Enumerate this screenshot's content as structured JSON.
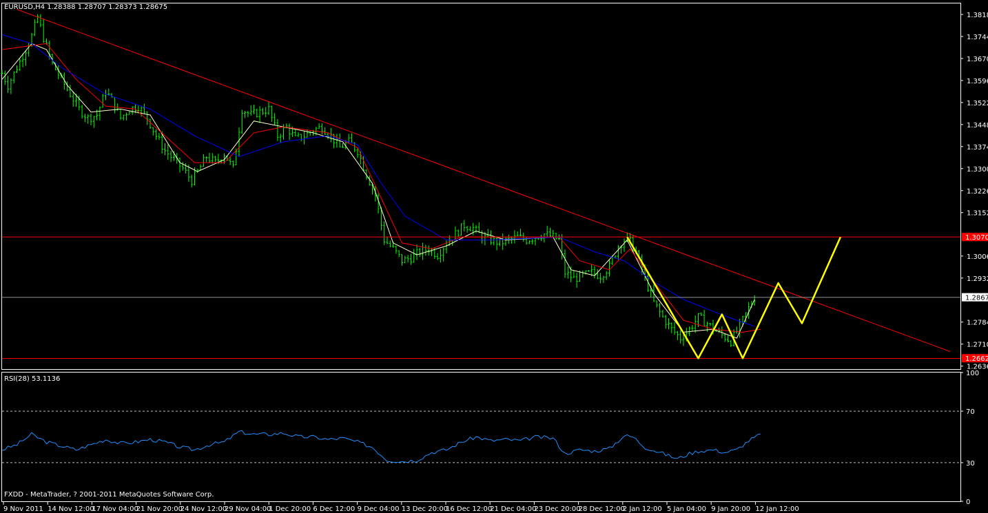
{
  "header": {
    "symbol_info": "EURUSD,H4  1.28388 1.28707 1.28373 1.28675"
  },
  "indicator": {
    "label": "RSI(28) 53.1136"
  },
  "footer": {
    "copyright": "FXDD - MetaTrader, ? 2001-2011 MetaQuotes Software Corp."
  },
  "colors": {
    "background": "#000000",
    "frame": "#ffffff",
    "candle": "#00ff00",
    "ma_fast": "#ffffcc",
    "ma_mid": "#ff0000",
    "ma_slow": "#0000ff",
    "trendline": "#ff0000",
    "level_line": "#ff0000",
    "current_line": "#c0c0c0",
    "rsi_line": "#1e90ff",
    "pattern": "#ffff00",
    "price_tag": "#ff0000"
  },
  "chart_data": {
    "type": "candlestick",
    "symbol": "EURUSD",
    "timeframe": "H4",
    "ylim": [
      1.2626,
      1.3855
    ],
    "y_ticks": [
      "1.38180",
      "1.37440",
      "1.36700",
      "1.35960",
      "1.35220",
      "1.34480",
      "1.33740",
      "1.33000",
      "1.32260",
      "1.31520",
      "1.30060",
      "1.29320",
      "1.27840",
      "1.27100",
      "1.26360"
    ],
    "x_ticks": [
      "9 Nov 2011",
      "14 Nov 12:00",
      "17 Nov 04:00",
      "21 Nov 20:00",
      "24 Nov 12:00",
      "29 Nov 04:00",
      "1 Dec 20:00",
      "6 Dec 12:00",
      "9 Dec 04:00",
      "13 Dec 20:00",
      "16 Dec 12:00",
      "21 Dec 04:00",
      "23 Dec 20:00",
      "28 Dec 12:00",
      "2 Jan 12:00",
      "5 Jan 04:00",
      "9 Jan 20:00",
      "12 Jan 12:00"
    ],
    "current_price": "1.28675",
    "tagged_levels": [
      "1.30700",
      "1.26625"
    ],
    "close_path": [
      [
        0,
        1.362
      ],
      [
        2,
        1.358
      ],
      [
        5,
        1.364
      ],
      [
        8,
        1.37
      ],
      [
        10,
        1.3745
      ],
      [
        12,
        1.381
      ],
      [
        14,
        1.374
      ],
      [
        17,
        1.365
      ],
      [
        20,
        1.36
      ],
      [
        23,
        1.355
      ],
      [
        26,
        1.35
      ],
      [
        29,
        1.347
      ],
      [
        32,
        1.348
      ],
      [
        35,
        1.356
      ],
      [
        37,
        1.353
      ],
      [
        40,
        1.347
      ],
      [
        43,
        1.35
      ],
      [
        46,
        1.351
      ],
      [
        49,
        1.347
      ],
      [
        52,
        1.341
      ],
      [
        55,
        1.336
      ],
      [
        58,
        1.333
      ],
      [
        61,
        1.33
      ],
      [
        64,
        1.326
      ],
      [
        66,
        1.329
      ],
      [
        69,
        1.334
      ],
      [
        72,
        1.332
      ],
      [
        75,
        1.335
      ],
      [
        78,
        1.33
      ],
      [
        81,
        1.35
      ],
      [
        84,
        1.348
      ],
      [
        87,
        1.349
      ],
      [
        90,
        1.35
      ],
      [
        93,
        1.341
      ],
      [
        96,
        1.344
      ],
      [
        99,
        1.34
      ],
      [
        102,
        1.341
      ],
      [
        105,
        1.343
      ],
      [
        108,
        1.344
      ],
      [
        111,
        1.341
      ],
      [
        114,
        1.337
      ],
      [
        117,
        1.339
      ],
      [
        120,
        1.336
      ],
      [
        123,
        1.328
      ],
      [
        126,
        1.321
      ],
      [
        129,
        1.306
      ],
      [
        132,
        1.303
      ],
      [
        135,
        1.299
      ],
      [
        138,
        1.3
      ],
      [
        141,
        1.302
      ],
      [
        144,
        1.303
      ],
      [
        147,
        1.301
      ],
      [
        150,
        1.305
      ],
      [
        153,
        1.308
      ],
      [
        156,
        1.311
      ],
      [
        159,
        1.31
      ],
      [
        162,
        1.307
      ],
      [
        165,
        1.306
      ],
      [
        168,
        1.305
      ],
      [
        171,
        1.306
      ],
      [
        174,
        1.307
      ],
      [
        177,
        1.306
      ],
      [
        180,
        1.307
      ],
      [
        183,
        1.308
      ],
      [
        186,
        1.307
      ],
      [
        188,
        1.306
      ],
      [
        190,
        1.295
      ],
      [
        193,
        1.293
      ],
      [
        196,
        1.294
      ],
      [
        199,
        1.295
      ],
      [
        202,
        1.294
      ],
      [
        205,
        1.297
      ],
      [
        208,
        1.304
      ],
      [
        211,
        1.307
      ],
      [
        214,
        1.302
      ],
      [
        217,
        1.293
      ],
      [
        220,
        1.285
      ],
      [
        223,
        1.28
      ],
      [
        226,
        1.276
      ],
      [
        229,
        1.273
      ],
      [
        232,
        1.276
      ],
      [
        235,
        1.28
      ],
      [
        238,
        1.278
      ],
      [
        240,
        1.276
      ],
      [
        243,
        1.274
      ],
      [
        246,
        1.272
      ],
      [
        249,
        1.277
      ],
      [
        252,
        1.283
      ],
      [
        254,
        1.2867
      ]
    ],
    "moving_averages": [
      {
        "color": "ma_fast",
        "values": [
          [
            0,
            1.36
          ],
          [
            10,
            1.372
          ],
          [
            15,
            1.37
          ],
          [
            22,
            1.358
          ],
          [
            30,
            1.349
          ],
          [
            40,
            1.35
          ],
          [
            50,
            1.348
          ],
          [
            60,
            1.332
          ],
          [
            66,
            1.329
          ],
          [
            75,
            1.333
          ],
          [
            85,
            1.346
          ],
          [
            95,
            1.344
          ],
          [
            105,
            1.342
          ],
          [
            115,
            1.339
          ],
          [
            125,
            1.325
          ],
          [
            132,
            1.305
          ],
          [
            140,
            1.301
          ],
          [
            150,
            1.304
          ],
          [
            160,
            1.309
          ],
          [
            170,
            1.306
          ],
          [
            186,
            1.307
          ],
          [
            192,
            1.296
          ],
          [
            200,
            1.294
          ],
          [
            211,
            1.306
          ],
          [
            220,
            1.288
          ],
          [
            230,
            1.275
          ],
          [
            240,
            1.276
          ],
          [
            248,
            1.273
          ],
          [
            254,
            1.286
          ]
        ]
      },
      {
        "color": "ma_mid",
        "values": [
          [
            0,
            1.37
          ],
          [
            15,
            1.372
          ],
          [
            25,
            1.36
          ],
          [
            35,
            1.351
          ],
          [
            45,
            1.35
          ],
          [
            55,
            1.341
          ],
          [
            65,
            1.332
          ],
          [
            75,
            1.332
          ],
          [
            85,
            1.342
          ],
          [
            95,
            1.344
          ],
          [
            110,
            1.342
          ],
          [
            120,
            1.337
          ],
          [
            128,
            1.32
          ],
          [
            135,
            1.305
          ],
          [
            145,
            1.303
          ],
          [
            155,
            1.307
          ],
          [
            165,
            1.307
          ],
          [
            188,
            1.307
          ],
          [
            195,
            1.299
          ],
          [
            205,
            1.296
          ],
          [
            212,
            1.303
          ],
          [
            220,
            1.292
          ],
          [
            230,
            1.279
          ],
          [
            240,
            1.276
          ],
          [
            250,
            1.275
          ],
          [
            256,
            1.276
          ]
        ]
      },
      {
        "color": "ma_slow",
        "values": [
          [
            0,
            1.375
          ],
          [
            10,
            1.372
          ],
          [
            20,
            1.364
          ],
          [
            35,
            1.355
          ],
          [
            50,
            1.35
          ],
          [
            65,
            1.341
          ],
          [
            80,
            1.334
          ],
          [
            95,
            1.339
          ],
          [
            110,
            1.341
          ],
          [
            120,
            1.338
          ],
          [
            128,
            1.325
          ],
          [
            136,
            1.314
          ],
          [
            150,
            1.306
          ],
          [
            165,
            1.306
          ],
          [
            188,
            1.307
          ],
          [
            200,
            1.302
          ],
          [
            210,
            1.299
          ],
          [
            220,
            1.292
          ],
          [
            230,
            1.286
          ],
          [
            240,
            1.282
          ],
          [
            248,
            1.279
          ],
          [
            254,
            1.277
          ]
        ]
      }
    ],
    "trendline": [
      [
        5,
        1.3835
      ],
      [
        320,
        1.2685
      ]
    ],
    "horizontal_levels": [
      1.307,
      1.2662
    ],
    "current_line": 1.2867,
    "pattern_projection": [
      [
        211,
        1.307
      ],
      [
        235,
        1.2662
      ],
      [
        243,
        1.281
      ],
      [
        250,
        1.2662
      ],
      [
        262,
        1.2915
      ],
      [
        270,
        1.278
      ],
      [
        283,
        1.307
      ]
    ],
    "rsi": {
      "ylim": [
        0,
        100
      ],
      "levels": [
        70,
        30
      ],
      "y_ticks": [
        "100",
        "70",
        "30",
        "0"
      ],
      "values": [
        [
          0,
          40
        ],
        [
          5,
          44
        ],
        [
          10,
          52
        ],
        [
          15,
          46
        ],
        [
          20,
          43
        ],
        [
          25,
          40
        ],
        [
          30,
          44
        ],
        [
          35,
          48
        ],
        [
          40,
          45
        ],
        [
          45,
          46
        ],
        [
          50,
          48
        ],
        [
          55,
          46
        ],
        [
          60,
          42
        ],
        [
          65,
          40
        ],
        [
          70,
          44
        ],
        [
          75,
          46
        ],
        [
          80,
          54
        ],
        [
          85,
          52
        ],
        [
          90,
          52
        ],
        [
          95,
          53
        ],
        [
          100,
          50
        ],
        [
          105,
          50
        ],
        [
          110,
          48
        ],
        [
          115,
          49
        ],
        [
          120,
          46
        ],
        [
          125,
          42
        ],
        [
          130,
          32
        ],
        [
          135,
          31
        ],
        [
          140,
          32
        ],
        [
          145,
          38
        ],
        [
          150,
          40
        ],
        [
          155,
          46
        ],
        [
          160,
          50
        ],
        [
          165,
          47
        ],
        [
          170,
          48
        ],
        [
          175,
          47
        ],
        [
          180,
          50
        ],
        [
          186,
          49
        ],
        [
          190,
          37
        ],
        [
          195,
          40
        ],
        [
          200,
          39
        ],
        [
          205,
          41
        ],
        [
          210,
          51
        ],
        [
          213,
          50
        ],
        [
          217,
          42
        ],
        [
          222,
          38
        ],
        [
          228,
          33
        ],
        [
          232,
          37
        ],
        [
          235,
          39
        ],
        [
          240,
          40
        ],
        [
          244,
          38
        ],
        [
          248,
          40
        ],
        [
          252,
          47
        ],
        [
          256,
          52
        ]
      ]
    }
  }
}
